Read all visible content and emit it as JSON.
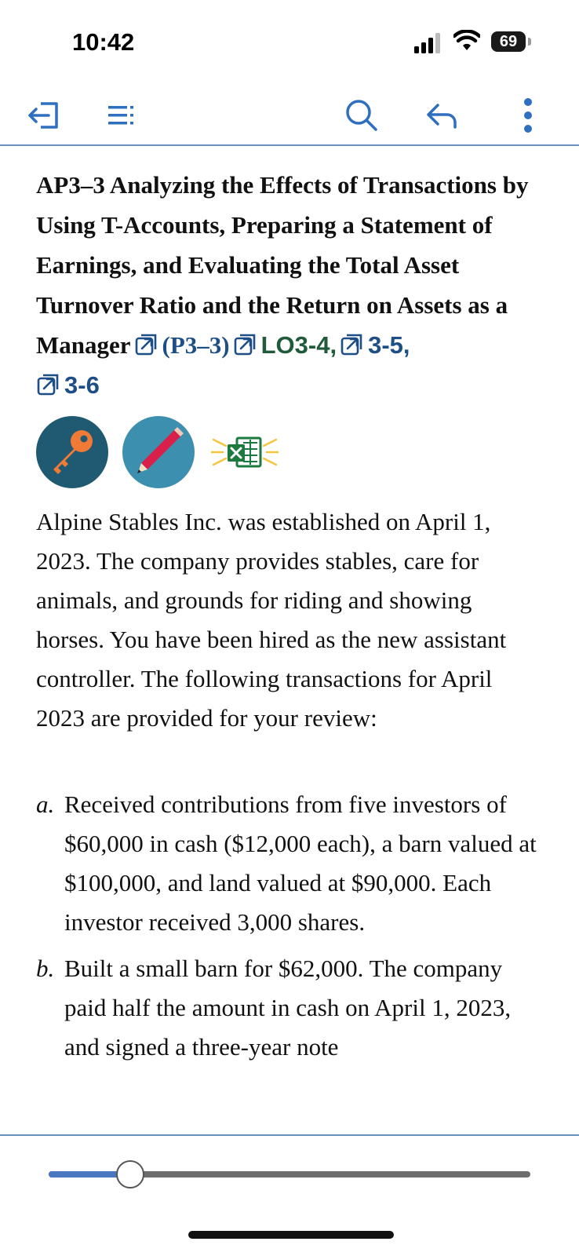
{
  "status_bar": {
    "time": "10:42",
    "battery": "69",
    "icons": [
      "signal-icon",
      "wifi-icon",
      "battery-icon"
    ]
  },
  "toolbar": {
    "icons": [
      "exit-icon",
      "table-of-contents-icon",
      "search-icon",
      "back-icon",
      "more-icon"
    ]
  },
  "problem": {
    "title": "AP3–3 Analyzing the Effects of Transactions by Using T-Accounts, Preparing a Statement of Earnings, and Evaluating the Total Asset Turnover Ratio and the Return on Assets as a Manager",
    "ref_problem": "(P3–3)",
    "ref_lo1": "LO3-4,",
    "ref_lo2": "3-5,",
    "ref_lo3": "3-6",
    "badges": [
      "key-icon",
      "pencil-icon",
      "excel-icon"
    ],
    "intro": "Alpine Stables Inc. was established on April 1, 2023. The company provides stables, care for animals, and grounds for riding and showing horses. You have been hired as the new assistant controller. The following transactions for April 2023 are provided for your review:",
    "items": [
      {
        "marker": "a.",
        "text": "Received contributions from five investors of $60,000 in cash ($12,000 each), a barn valued at $100,000, and land valued at $90,000. Each investor received 3,000 shares."
      },
      {
        "marker": "b.",
        "text": "Built a small barn for $62,000. The company paid half the amount in cash on April 1, 2023, and signed a three-year note"
      }
    ]
  },
  "reader": {
    "progress": 0.17
  },
  "colors": {
    "accent": "#1d4f86",
    "lo_green": "#1f5a3a",
    "rule_blue": "#6a8fbf",
    "key_badge": "#1f5a72",
    "key_orange": "#f07a36",
    "pencil_badge": "#3d8fb0",
    "excel_green": "#1d7a3e"
  }
}
